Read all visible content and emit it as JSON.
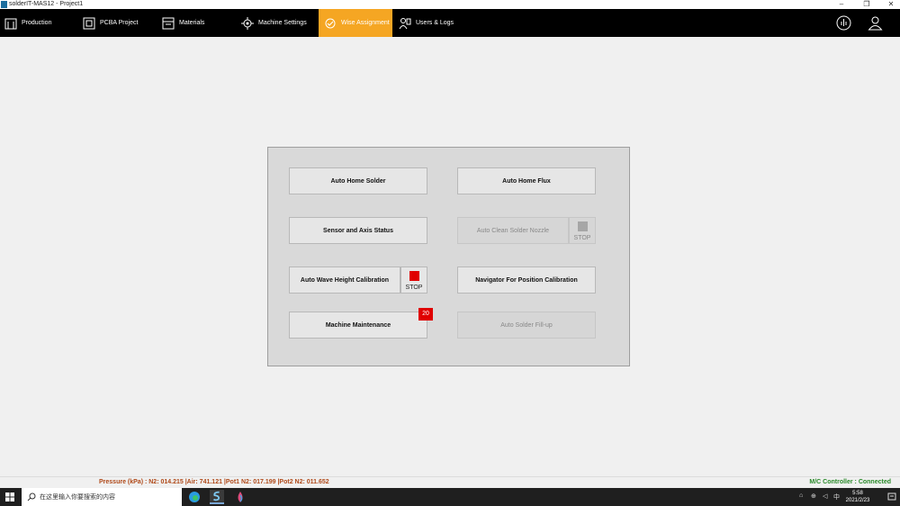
{
  "window": {
    "title": "solderIT-MAS12 - Project1",
    "minimize_glyph": "–",
    "restore_glyph": "❐",
    "close_glyph": "✕"
  },
  "nav": {
    "tabs": [
      {
        "label": "Production",
        "icon": "production-icon"
      },
      {
        "label": "PCBA Project",
        "icon": "pcb-icon"
      },
      {
        "label": "Materials",
        "icon": "materials-icon"
      },
      {
        "label": "Machine Settings",
        "icon": "settings-gear-icon"
      },
      {
        "label": "Wise Assignment",
        "icon": "wise-assignment-icon",
        "active": true
      },
      {
        "label": "Users & Logs",
        "icon": "users-logs-icon"
      }
    ],
    "right_icons": [
      "hand-info-icon",
      "user-profile-icon"
    ],
    "active_color": "#f5a623"
  },
  "panel": {
    "auto_home_solder": "Auto Home Solder",
    "auto_home_flux": "Auto Home Flux",
    "sensor_axis_status": "Sensor and Axis Status",
    "auto_clean_nozzle": "Auto Clean Solder Nozzle",
    "auto_clean_stop": "STOP",
    "auto_wave_height": "Auto Wave Height Calibration",
    "auto_wave_stop": "STOP",
    "navigator_position": "Navigator For Position Calibration",
    "machine_maintenance": "Machine Maintenance",
    "maintenance_badge": "20",
    "auto_solder_fill": "Auto Solder Fill-up"
  },
  "status": {
    "pressure": "Pressure (kPa) :  N2: 014.215 |Air: 741.121 |Pot1 N2: 017.199 |Pot2 N2: 011.652",
    "controller": "M/C Controller : Connected"
  },
  "taskbar": {
    "search_placeholder": "在这里输入你要搜索的内容",
    "time": "5:58",
    "date": "2021/2/23",
    "ime": "中"
  }
}
